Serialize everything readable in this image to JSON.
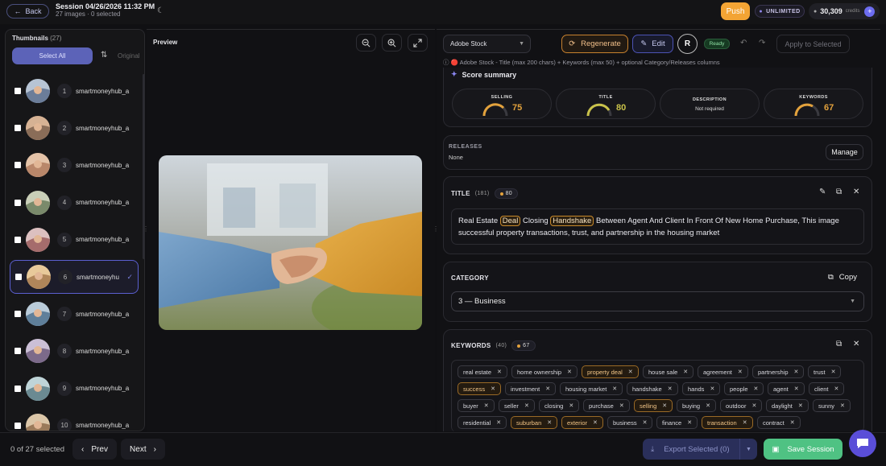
{
  "header": {
    "back_label": "Back",
    "session_title": "Session 04/26/2026 11:32 PM",
    "session_sub": "27 images · 0 selected",
    "push_label": "Push",
    "unlimited_label": "UNLIMITED",
    "credits_value": "30,309",
    "credits_label": "credits"
  },
  "thumbnails": {
    "title": "Thumbnails",
    "count": "(27)",
    "select_all": "Select All",
    "original": "Original",
    "items": [
      {
        "num": "1",
        "name": "smartmoneyhub_a"
      },
      {
        "num": "2",
        "name": "smartmoneyhub_a"
      },
      {
        "num": "3",
        "name": "smartmoneyhub_a"
      },
      {
        "num": "4",
        "name": "smartmoneyhub_a"
      },
      {
        "num": "5",
        "name": "smartmoneyhub_a"
      },
      {
        "num": "6",
        "name": "smartmoneyhu"
      },
      {
        "num": "7",
        "name": "smartmoneyhub_a"
      },
      {
        "num": "8",
        "name": "smartmoneyhub_a"
      },
      {
        "num": "9",
        "name": "smartmoneyhub_a"
      },
      {
        "num": "10",
        "name": "smartmoneyhub_a"
      }
    ]
  },
  "preview": {
    "label": "Preview"
  },
  "toolbar": {
    "preset": "Adobe Stock",
    "regenerate": "Regenerate",
    "edit": "Edit",
    "r": "R",
    "status": "Ready",
    "apply": "Apply to Selected",
    "info_prefix": "🔴",
    "info": "Adobe Stock - Title (max 200 chars) + Keywords (max 50) + optional Category/Releases columns"
  },
  "score": {
    "title": "Score summary",
    "selling_label": "SELLING",
    "selling_value": "75",
    "title_label": "TITLE",
    "title_value": "80",
    "desc_label": "DESCRIPTION",
    "desc_value": "Not required",
    "keywords_label": "KEYWORDS",
    "keywords_value": "67"
  },
  "releases": {
    "label": "RELEASES",
    "value": "None",
    "manage": "Manage"
  },
  "title_section": {
    "label": "TITLE",
    "count": "(181)",
    "score": "80",
    "t1": "Real Estate",
    "h1": "Deal",
    "t2": "Closing",
    "h2": "Handshake",
    "t3": "Between Agent And Client In Front Of New Home Purchase, This image successful property transactions, trust, and partnership in the housing market"
  },
  "category": {
    "label": "CATEGORY",
    "copy": "Copy",
    "value": "3 — Business"
  },
  "keywords": {
    "label": "KEYWORDS",
    "count": "(40)",
    "score": "67",
    "rows": [
      [
        {
          "t": "real estate",
          "g": false
        },
        {
          "t": "home ownership",
          "g": false
        },
        {
          "t": "property deal",
          "g": true
        },
        {
          "t": "house sale",
          "g": false
        },
        {
          "t": "agreement",
          "g": false
        },
        {
          "t": "partnership",
          "g": false
        },
        {
          "t": "trust",
          "g": false
        }
      ],
      [
        {
          "t": "success",
          "g": true
        },
        {
          "t": "investment",
          "g": false
        },
        {
          "t": "housing market",
          "g": false
        },
        {
          "t": "handshake",
          "g": false
        },
        {
          "t": "hands",
          "g": false
        },
        {
          "t": "people",
          "g": false
        },
        {
          "t": "agent",
          "g": false
        },
        {
          "t": "client",
          "g": false
        }
      ],
      [
        {
          "t": "buyer",
          "g": false
        },
        {
          "t": "seller",
          "g": false
        },
        {
          "t": "closing",
          "g": false
        },
        {
          "t": "purchase",
          "g": false
        },
        {
          "t": "selling",
          "g": true
        },
        {
          "t": "buying",
          "g": false
        },
        {
          "t": "outdoor",
          "g": false
        },
        {
          "t": "daylight",
          "g": false
        },
        {
          "t": "sunny",
          "g": false
        }
      ],
      [
        {
          "t": "residential",
          "g": false
        },
        {
          "t": "suburban",
          "g": true
        },
        {
          "t": "exterior",
          "g": true
        },
        {
          "t": "business",
          "g": false
        },
        {
          "t": "finance",
          "g": false
        },
        {
          "t": "transaction",
          "g": true
        },
        {
          "t": "contract",
          "g": false
        }
      ]
    ]
  },
  "footer": {
    "selected": "0 of 27 selected",
    "prev": "Prev",
    "next": "Next",
    "export": "Export Selected (0)",
    "save": "Save Session"
  },
  "colors": {
    "accent": "#5c63b8",
    "gold": "#e3a23c",
    "green": "#4fc283",
    "push": "#f3a434"
  }
}
